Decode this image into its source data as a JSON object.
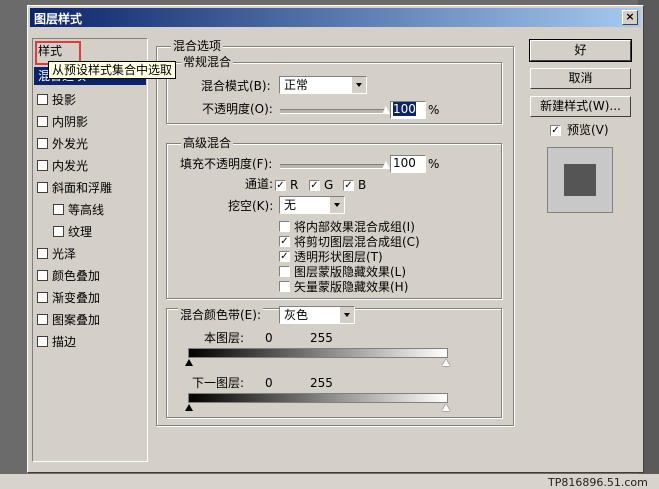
{
  "dialog": {
    "title": "图层样式",
    "close": "×"
  },
  "styles": {
    "header": "样式",
    "selected": "混合选项",
    "tooltip": "从预设样式集合中选取",
    "items": [
      {
        "label": "投影",
        "checked": false,
        "sub": false
      },
      {
        "label": "内阴影",
        "checked": false,
        "sub": false
      },
      {
        "label": "外发光",
        "checked": false,
        "sub": false
      },
      {
        "label": "内发光",
        "checked": false,
        "sub": false
      },
      {
        "label": "斜面和浮雕",
        "checked": false,
        "sub": false
      },
      {
        "label": "等高线",
        "checked": false,
        "sub": true
      },
      {
        "label": "纹理",
        "checked": false,
        "sub": true
      },
      {
        "label": "光泽",
        "checked": false,
        "sub": false
      },
      {
        "label": "颜色叠加",
        "checked": false,
        "sub": false
      },
      {
        "label": "渐变叠加",
        "checked": false,
        "sub": false
      },
      {
        "label": "图案叠加",
        "checked": false,
        "sub": false
      },
      {
        "label": "描边",
        "checked": false,
        "sub": false
      }
    ]
  },
  "blend": {
    "title": "混合选项",
    "general": {
      "title": "常规混合",
      "mode_label": "混合模式(B):",
      "mode_value": "正常",
      "opacity_label": "不透明度(O):",
      "opacity_value": "100",
      "opacity_unit": "%",
      "opacity_level": 1.0
    },
    "advanced": {
      "title": "高级混合",
      "fill_label": "填充不透明度(F):",
      "fill_value": "100",
      "fill_unit": "%",
      "fill_level": 1.0,
      "channels_label": "通道:",
      "channels": [
        {
          "label": "R",
          "checked": true
        },
        {
          "label": "G",
          "checked": true
        },
        {
          "label": "B",
          "checked": true
        }
      ],
      "knockout_label": "挖空(K):",
      "knockout_value": "无",
      "options": [
        {
          "label": "将内部效果混合成组(I)",
          "checked": false
        },
        {
          "label": "将剪切图层混合成组(C)",
          "checked": true
        },
        {
          "label": "透明形状图层(T)",
          "checked": true
        },
        {
          "label": "图层蒙版隐藏效果(L)",
          "checked": false
        },
        {
          "label": "矢量蒙版隐藏效果(H)",
          "checked": false
        }
      ]
    },
    "band": {
      "label": "混合颜色带(E):",
      "value": "灰色",
      "this_layer": {
        "label": "本图层:",
        "min": "0",
        "max": "255"
      },
      "under_layer": {
        "label": "下一图层:",
        "min": "0",
        "max": "255"
      }
    }
  },
  "buttons": {
    "ok": "好",
    "cancel": "取消",
    "new_style": "新建样式(W)...",
    "preview": "预览(V)",
    "preview_checked": true
  },
  "watermark": "TP816896.51.com"
}
